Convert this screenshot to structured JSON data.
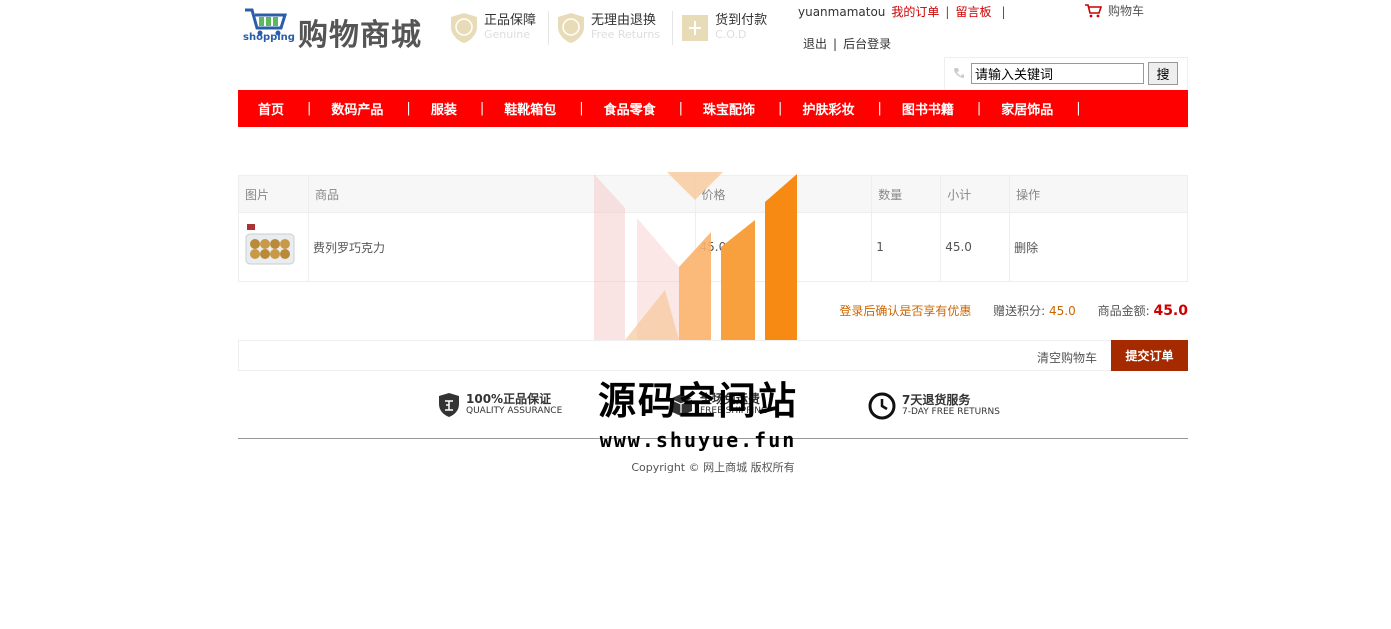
{
  "header": {
    "logo_text": "购物商城",
    "logo_sub": "shopping",
    "badges": [
      {
        "cn": "正品保障",
        "en": "Genuine",
        "icon": "genuine-shield-icon"
      },
      {
        "cn": "无理由退换",
        "en": "Free Returns",
        "icon": "return-shield-icon"
      },
      {
        "cn": "货到付款",
        "en": "C.O.D",
        "icon": "cod-icon"
      }
    ],
    "username": "yuanmamatou",
    "my_orders": "我的订单",
    "message_board": "留言板",
    "sep": "|",
    "cart": "购物车",
    "logout": "退出",
    "admin_login": "后台登录"
  },
  "search": {
    "value": "请输入关键词",
    "button": "搜"
  },
  "nav": {
    "items": [
      "首页",
      "数码产品",
      "服装",
      "鞋靴箱包",
      "食品零食",
      "珠宝配饰",
      "护肤彩妆",
      "图书书籍",
      "家居饰品"
    ],
    "separator": "|"
  },
  "cart_table": {
    "headers": [
      "图片",
      "商品",
      "价格",
      "数量",
      "小计",
      "操作"
    ],
    "rows": [
      {
        "name": "费列罗巧克力",
        "price": "45.0",
        "qty": "1",
        "subtotal": "45.0",
        "action": "删除"
      }
    ]
  },
  "summary": {
    "login_note": "登录后确认是否享有优惠",
    "points_label": "赠送积分:",
    "points": "45.0",
    "amount_label": "商品金额:",
    "amount": "45.0"
  },
  "actions": {
    "clear": "清空购物车",
    "submit": "提交订单"
  },
  "services": [
    {
      "cn": "100%正品保证",
      "en": "QUALITY ASSURANCE",
      "icon": "quality-shield-icon"
    },
    {
      "cn": "全场免运费",
      "en": "FREE SHIPPING",
      "icon": "box-icon"
    },
    {
      "cn": "7天退货服务",
      "en": "7-DAY FREE RETURNS",
      "icon": "clock-icon"
    }
  ],
  "footer": {
    "copyright": "Copyright © 网上商城 版权所有"
  },
  "watermark": {
    "title": "源码空间站",
    "url": "www.shuyue.fun"
  },
  "colors": {
    "nav_red": "#ff0000",
    "submit_brown": "#a52a00",
    "accent_orange": "#cc6600",
    "price_red": "#cc0000"
  }
}
